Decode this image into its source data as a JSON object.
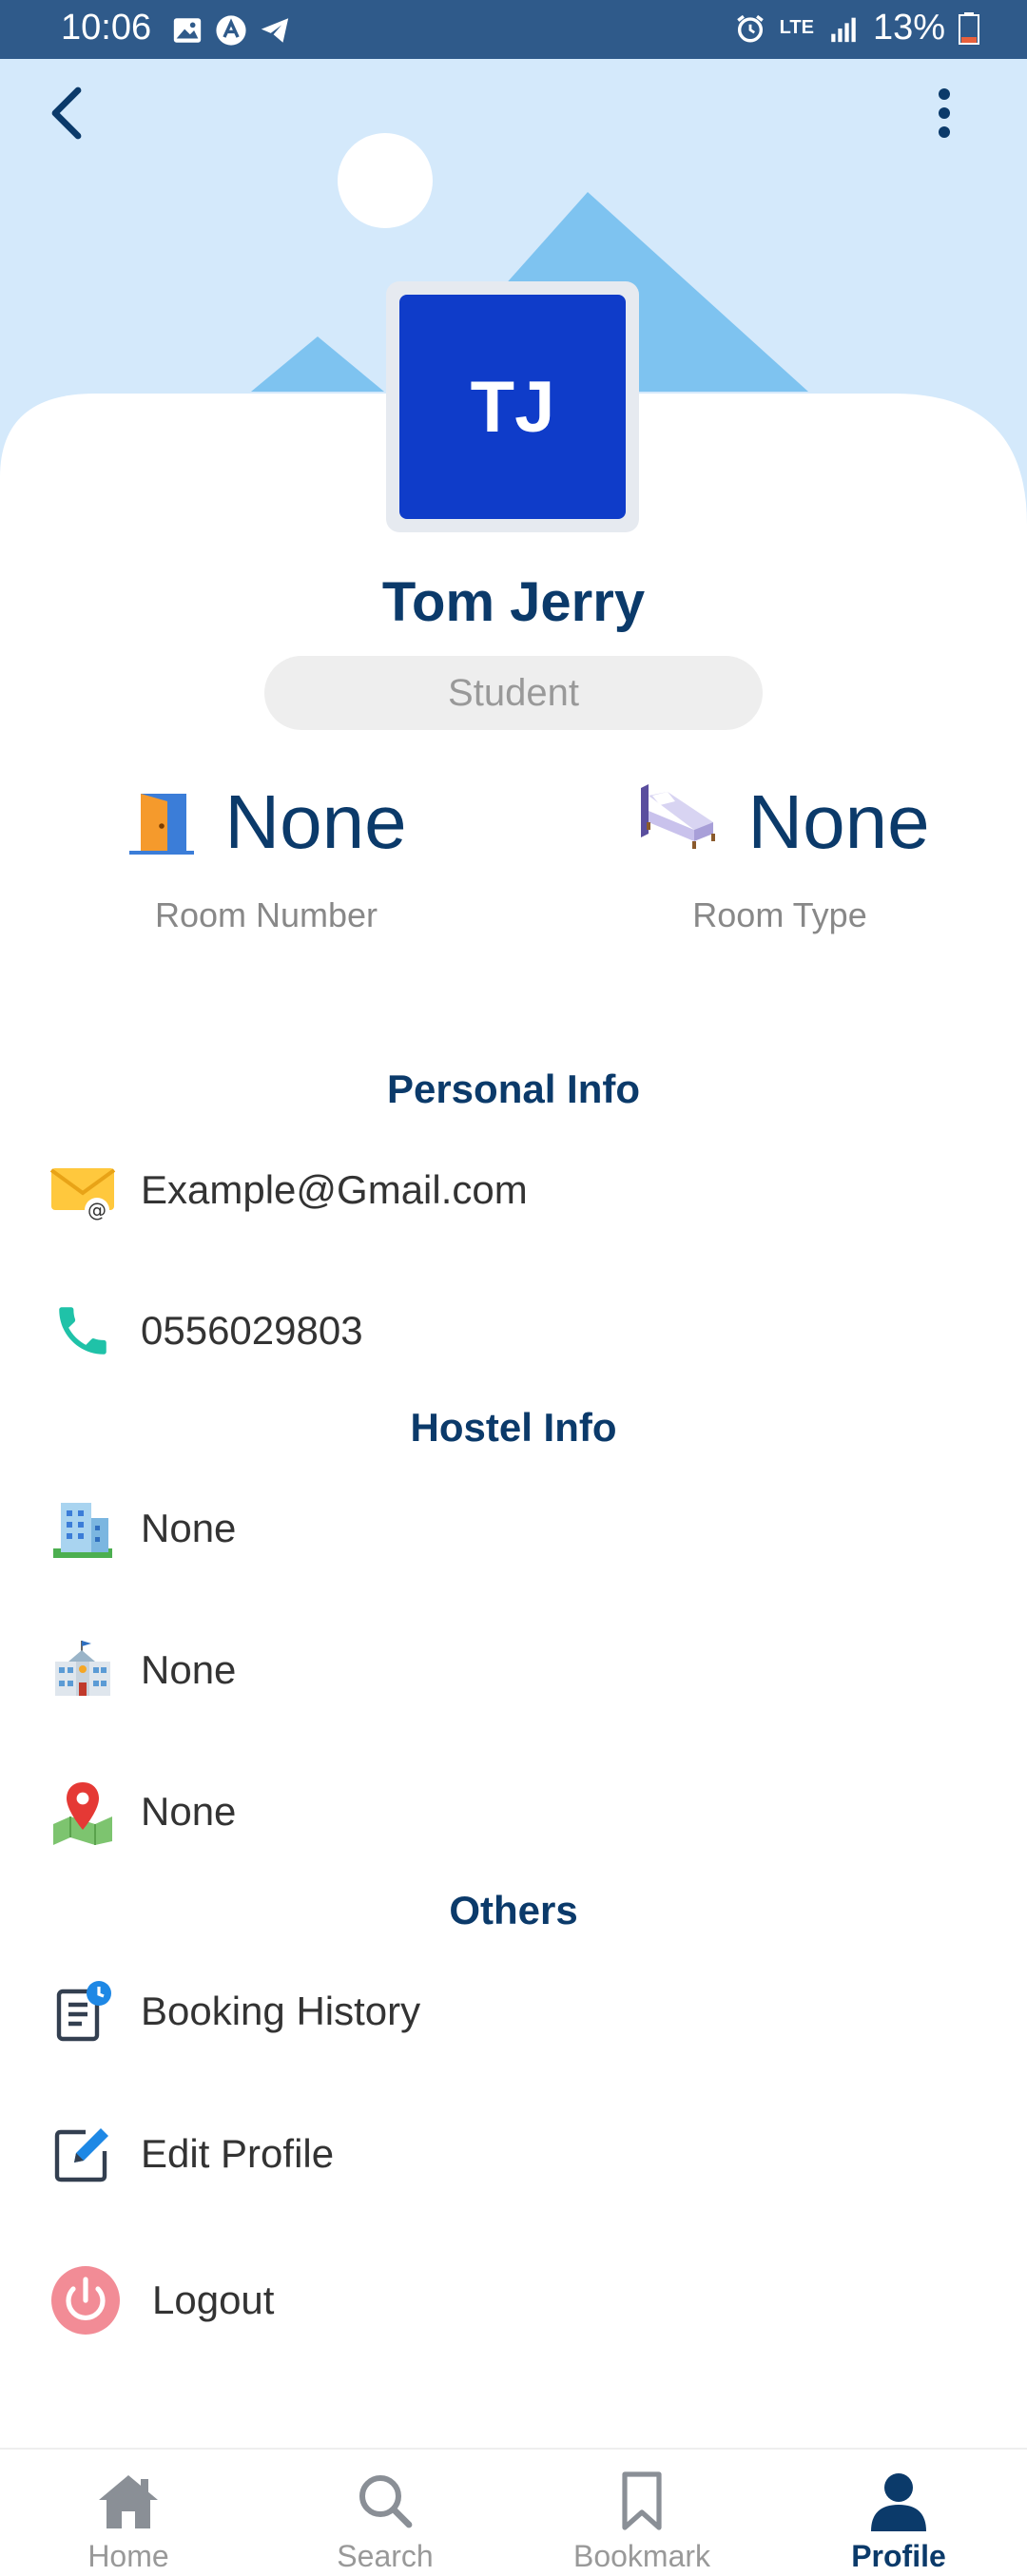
{
  "status_bar": {
    "time": "10:06",
    "network": "LTE",
    "battery": "13%"
  },
  "profile": {
    "initials": "TJ",
    "name": "Tom Jerry",
    "role": "Student"
  },
  "stats": {
    "room_number_value": "None",
    "room_number_label": "Room Number",
    "room_type_value": "None",
    "room_type_label": "Room Type"
  },
  "personal_info": {
    "title": "Personal Info",
    "email": "Example@Gmail.com",
    "phone": "0556029803"
  },
  "hostel_info": {
    "title": "Hostel Info",
    "hostel_name": "None",
    "institution": "None",
    "location": "None"
  },
  "others": {
    "title": "Others",
    "booking_history": "Booking History",
    "edit_profile": "Edit Profile",
    "logout": "Logout"
  },
  "bottom_nav": {
    "items": [
      {
        "label": "Home",
        "icon": "home-icon",
        "active": false
      },
      {
        "label": "Search",
        "icon": "search-icon",
        "active": false
      },
      {
        "label": "Bookmark",
        "icon": "bookmark-icon",
        "active": false
      },
      {
        "label": "Profile",
        "icon": "person-icon",
        "active": true
      }
    ]
  },
  "colors": {
    "status_bar": "#2f5a8a",
    "header_sky": "#d4e9fb",
    "mountain": "#7ec3f0",
    "avatar": "#0f3cc9",
    "primary_text": "#0b3a6a"
  }
}
